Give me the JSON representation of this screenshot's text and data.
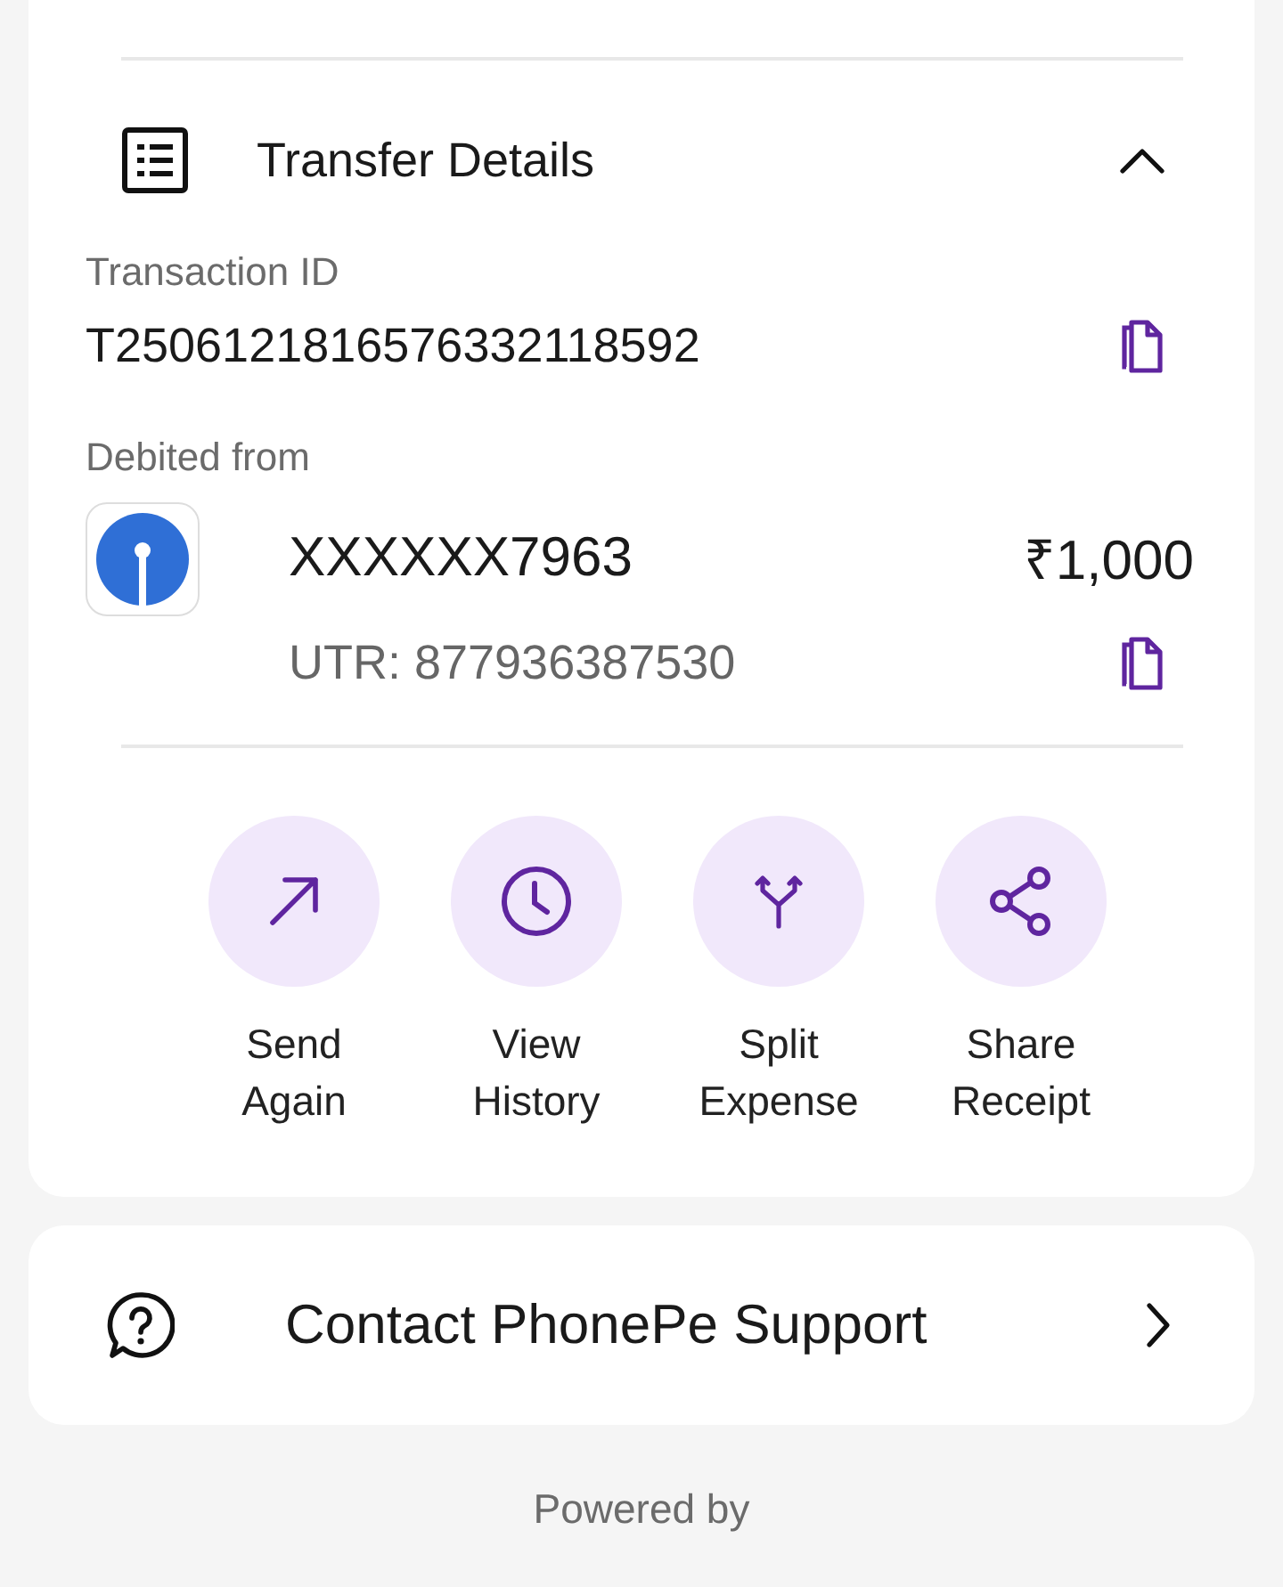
{
  "transfer_details": {
    "title": "Transfer Details",
    "expanded": true,
    "transaction_id_label": "Transaction ID",
    "transaction_id": "T2506121816576332118592",
    "debited_from_label": "Debited from",
    "account": "XXXXXX7963",
    "amount": "₹1,000",
    "utr": "UTR: 877936387530"
  },
  "actions": [
    {
      "kind": "send",
      "label": "Send Again"
    },
    {
      "kind": "history",
      "label": "View History"
    },
    {
      "kind": "split",
      "label": "Split Expense"
    },
    {
      "kind": "share",
      "label": "Share Receipt"
    }
  ],
  "support": {
    "label": "Contact PhonePe Support"
  },
  "footer": "Powered by"
}
